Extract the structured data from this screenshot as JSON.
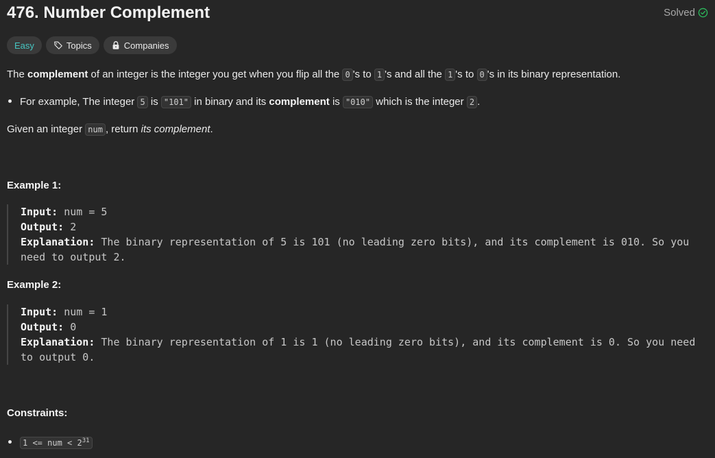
{
  "header": {
    "title": "476. Number Complement",
    "status": "Solved"
  },
  "tags": {
    "difficulty": "Easy",
    "topics": "Topics",
    "companies": "Companies"
  },
  "description": {
    "p1_a": "The ",
    "p1_b": "complement",
    "p1_c": " of an integer is the integer you get when you flip all the ",
    "p1_code1": "0",
    "p1_d": "'s to ",
    "p1_code2": "1",
    "p1_e": "'s and all the ",
    "p1_code3": "1",
    "p1_f": "'s to ",
    "p1_code4": "0",
    "p1_g": "'s in its binary representation.",
    "b1_a": "For example, The integer ",
    "b1_code1": "5",
    "b1_b": " is ",
    "b1_code2": "\"101\"",
    "b1_c": " in binary and its ",
    "b1_d": "complement",
    "b1_e": " is ",
    "b1_code3": "\"010\"",
    "b1_f": " which is the integer ",
    "b1_code4": "2",
    "b1_g": ".",
    "p2_a": "Given an integer ",
    "p2_code": "num",
    "p2_b": ", return ",
    "p2_c": "its complement",
    "p2_d": "."
  },
  "examples": [
    {
      "heading": "Example 1:",
      "input_label": "Input:",
      "input": " num = 5",
      "output_label": "Output:",
      "output": " 2",
      "explanation_label": "Explanation:",
      "explanation": " The binary representation of 5 is 101 (no leading zero bits), and its complement is 010. So you need to output 2."
    },
    {
      "heading": "Example 2:",
      "input_label": "Input:",
      "input": " num = 1",
      "output_label": "Output:",
      "output": " 0",
      "explanation_label": "Explanation:",
      "explanation": " The binary representation of 1 is 1 (no leading zero bits), and its complement is 0. So you need to output 0."
    }
  ],
  "constraints": {
    "heading": "Constraints:",
    "item_a": "1 <= num < 2",
    "item_sup": "31"
  },
  "colors": {
    "background": "#262626",
    "easy": "#46c6c2",
    "solved_check": "#2cbb5d"
  }
}
